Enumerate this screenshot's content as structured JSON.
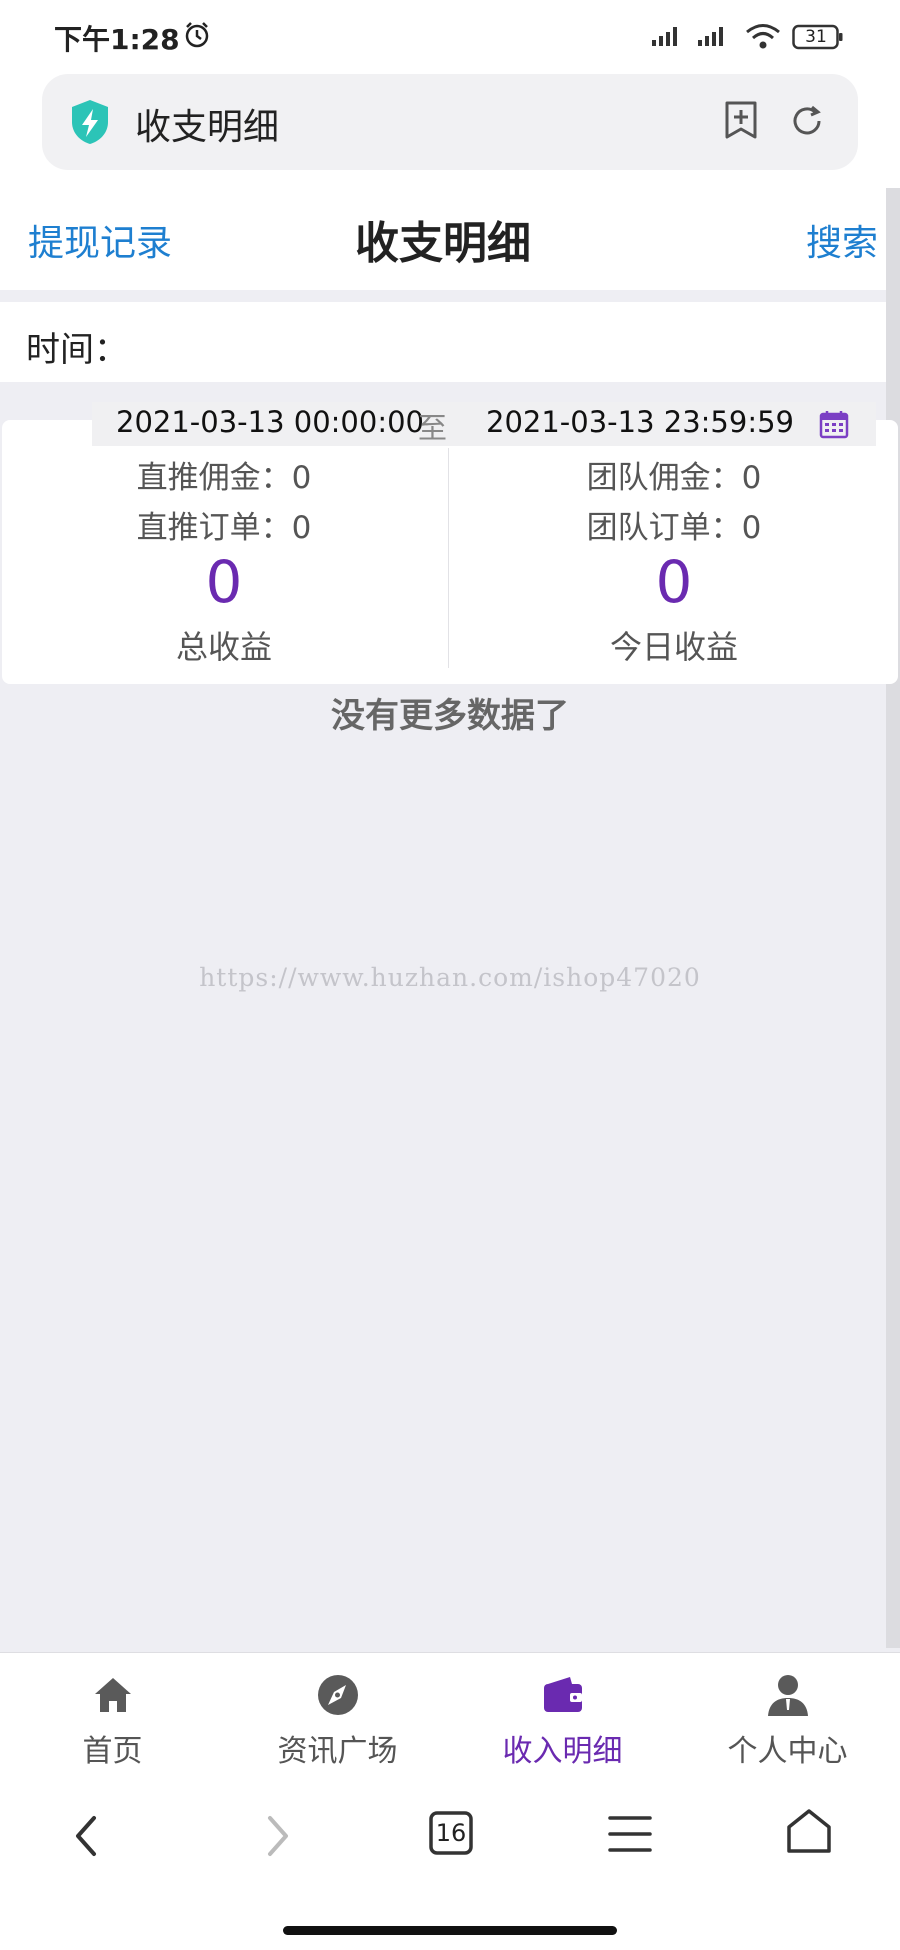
{
  "status_bar": {
    "time": "下午1:28",
    "battery": "31"
  },
  "browser": {
    "address_title": "收支明细",
    "tab_count": "16"
  },
  "header": {
    "left_link": "提现记录",
    "title": "收支明细",
    "right_link": "搜索"
  },
  "filter": {
    "time_label": "时间：",
    "start": "2021-03-13 00:00:00",
    "separator": "至",
    "end": "2021-03-13 23:59:59"
  },
  "stats": {
    "direct_commission": "直推佣金：0",
    "team_commission": "团队佣金：0",
    "direct_orders": "直推订单：0",
    "team_orders": "团队订单：0",
    "total_value": "0",
    "total_label": "总收益",
    "today_value": "0",
    "today_label": "今日收益"
  },
  "no_more": "没有更多数据了",
  "watermark": "https://www.huzhan.com/ishop47020",
  "tabs": [
    {
      "label": "首页",
      "icon": "home-icon"
    },
    {
      "label": "资讯广场",
      "icon": "compass-icon"
    },
    {
      "label": "收入明细",
      "icon": "wallet-icon",
      "active": true
    },
    {
      "label": "个人中心",
      "icon": "user-icon"
    }
  ],
  "colors": {
    "accent": "#6a2ab0",
    "link": "#1e7fd0",
    "background": "#eeeef3"
  }
}
